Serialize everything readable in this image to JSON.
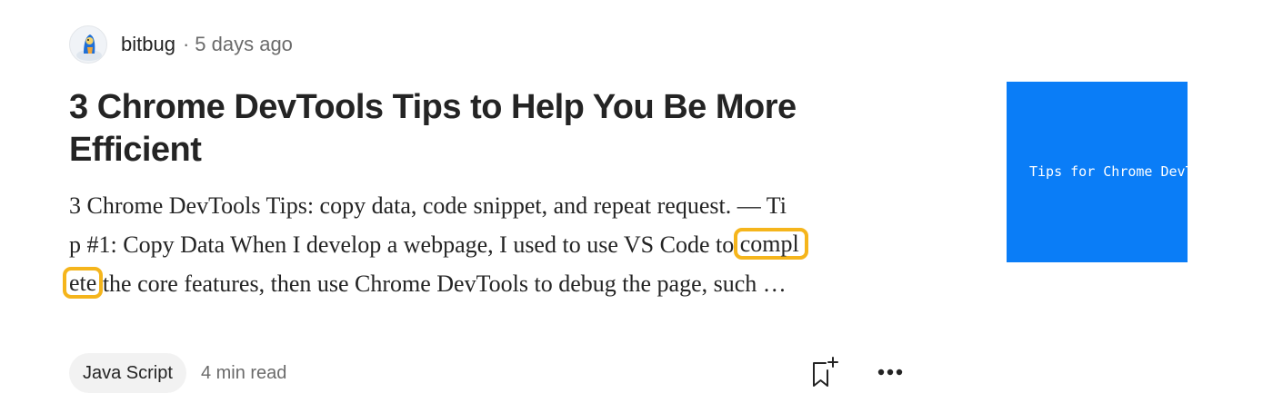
{
  "author": {
    "name": "bitbug",
    "separator": "·",
    "time": "5 days ago",
    "avatar_icon": "avatar-icon"
  },
  "article": {
    "title_line1": "3 Chrome DevTools Tips to Help You Be More",
    "title_line2": "Efficient",
    "excerpt": {
      "line1": "3 Chrome DevTools Tips: copy data, code snippet, and repeat request. — Ti",
      "line2_pre": "p #1: Copy Data When I develop a webpage, I used to use VS Code to ",
      "line2_highlight": "compl",
      "line3_highlight": "ete",
      "line3_post": " the core features, then use Chrome DevTools to debug the page, such …"
    },
    "highlight_color": "#f5b51c"
  },
  "footer": {
    "tag": "Java Script",
    "read_time": "4 min read",
    "bookmark_icon": "bookmark-add-icon",
    "more_icon": "more-options-icon"
  },
  "thumbnail": {
    "text": "Tips for Chrome DevTools",
    "background": "#0a7df7"
  }
}
